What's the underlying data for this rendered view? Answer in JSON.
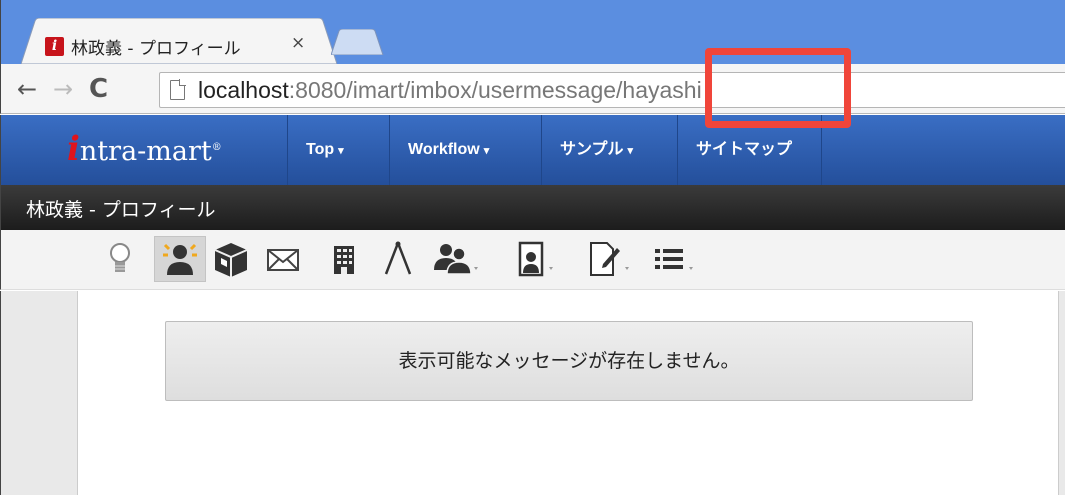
{
  "browser": {
    "tab_title": "林政義 - プロフィール",
    "tab_close": "×",
    "favicon_letter": "i",
    "url_host": "localhost",
    "url_rest": ":8080/imart/imbox/usermessage/hayashi",
    "highlight_color": "#f0453a"
  },
  "app": {
    "logo_initial": "i",
    "logo_text": "ntra-mart",
    "logo_mark": "®",
    "menu": [
      {
        "label": "Top",
        "caret": "▾"
      },
      {
        "label": "Workflow",
        "caret": "▾"
      },
      {
        "label": "サンプル",
        "caret": "▾"
      },
      {
        "label": "サイトマップ"
      }
    ],
    "page_title": "林政義 - プロフィール"
  },
  "icon_bar": [
    {
      "icon": "lightbulb-icon"
    },
    {
      "icon": "profile-icon",
      "active": true
    },
    {
      "icon": "box-icon"
    },
    {
      "icon": "mail-icon"
    },
    {
      "icon": "building-icon"
    },
    {
      "icon": "compass-icon"
    },
    {
      "icon": "users-icon",
      "dropdown": true
    },
    {
      "icon": "device-user-icon",
      "dropdown": true
    },
    {
      "icon": "document-edit-icon",
      "dropdown": true
    },
    {
      "icon": "list-icon",
      "dropdown": true
    }
  ],
  "main": {
    "empty_message": "表示可能なメッセージが存在しません。"
  }
}
